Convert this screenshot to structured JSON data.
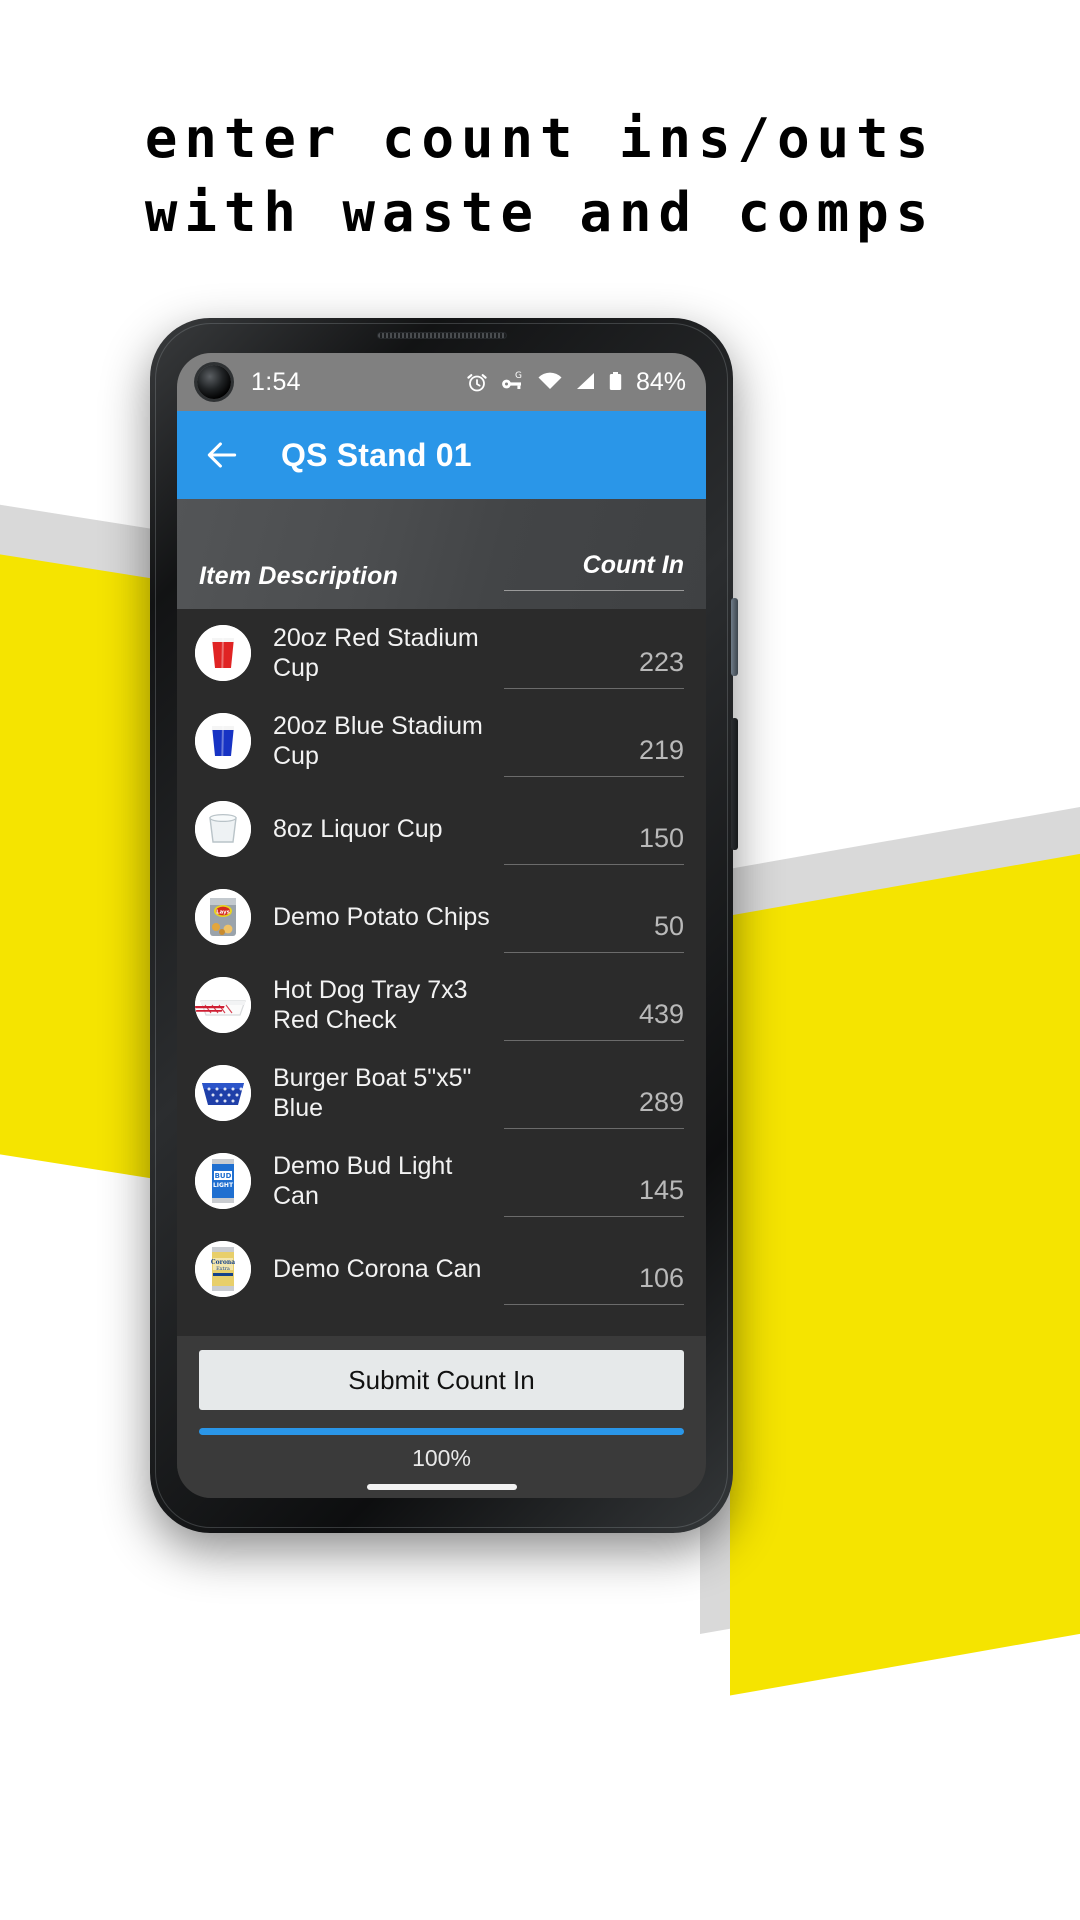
{
  "headline": {
    "line1": "enter count ins/outs",
    "line2": "with waste and comps"
  },
  "status_bar": {
    "time": "1:54",
    "battery_percent": "84%",
    "icons": [
      "alarm-icon",
      "vpn-key-g-icon",
      "wifi-icon",
      "cell-signal-icon",
      "battery-icon"
    ]
  },
  "app_bar": {
    "back_label": "Back",
    "title": "QS Stand 01"
  },
  "table": {
    "header_description": "Item Description",
    "header_count": "Count In",
    "rows": [
      {
        "thumb": "red-stadium-cup-icon",
        "name": "20oz Red Stadium Cup",
        "count": "223"
      },
      {
        "thumb": "blue-stadium-cup-icon",
        "name": "20oz Blue Stadium Cup",
        "count": "219"
      },
      {
        "thumb": "clear-liquor-cup-icon",
        "name": "8oz Liquor Cup",
        "count": "150"
      },
      {
        "thumb": "potato-chips-icon",
        "name": "Demo Potato Chips",
        "count": "50"
      },
      {
        "thumb": "hot-dog-tray-icon",
        "name": "Hot Dog Tray 7x3 Red Check",
        "count": "439"
      },
      {
        "thumb": "burger-boat-icon",
        "name": "Burger Boat 5\"x5\" Blue",
        "count": "289"
      },
      {
        "thumb": "bud-light-can-icon",
        "name": "Demo Bud Light Can",
        "count": "145"
      },
      {
        "thumb": "corona-can-icon",
        "name": "Demo Corona Can",
        "count": "106"
      }
    ]
  },
  "bottom": {
    "submit_label": "Submit Count In",
    "progress_percent": 100,
    "progress_label": "100%"
  },
  "colors": {
    "accent_blue": "#2a96e8",
    "banner_yellow": "#f5e400",
    "list_bg": "#2b2b2b",
    "status_bg": "#808080"
  }
}
